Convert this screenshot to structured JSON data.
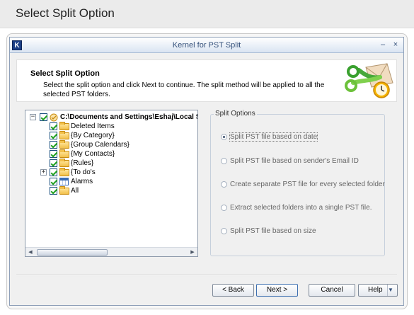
{
  "page": {
    "title": "Select Split Option"
  },
  "window": {
    "app_icon": "K",
    "title": "Kernel for PST Split",
    "minimize_glyph": "–",
    "close_glyph": "×"
  },
  "header": {
    "title": "Select Split Option",
    "description": "Select the split option and click Next to continue. The split method will be applied to all the selected PST folders.",
    "logo_icon": "scissors-clock-envelope-icon"
  },
  "tree": {
    "root": {
      "label": "C:\\Documents and Settings\\Eshaj\\Local S",
      "expander": "−",
      "checked": true
    },
    "items": [
      {
        "label": "Deleted Items",
        "icon": "folder-icon",
        "checked": true,
        "expander": ""
      },
      {
        "label": "{By Category}",
        "icon": "folder-icon",
        "checked": true,
        "expander": ""
      },
      {
        "label": "{Group Calendars}",
        "icon": "folder-icon",
        "checked": true,
        "expander": ""
      },
      {
        "label": "{My Contacts}",
        "icon": "folder-icon",
        "checked": true,
        "expander": ""
      },
      {
        "label": "{Rules}",
        "icon": "folder-icon",
        "checked": true,
        "expander": ""
      },
      {
        "label": "{To do's",
        "icon": "folder-icon",
        "checked": true,
        "expander": "+"
      },
      {
        "label": "Alarms",
        "icon": "calendar-icon",
        "checked": true,
        "expander": ""
      },
      {
        "label": "All",
        "icon": "folder-icon",
        "checked": true,
        "expander": ""
      }
    ],
    "scroll_left": "◀",
    "scroll_right": "▶"
  },
  "split_options": {
    "legend": "Split Options",
    "options": [
      {
        "label": "Split PST file based on date",
        "selected": true
      },
      {
        "label": "Split PST file based on sender's Email ID",
        "selected": false
      },
      {
        "label": "Create separate PST file for every selected folder",
        "selected": false
      },
      {
        "label": "Extract selected folders into a single PST file.",
        "selected": false
      },
      {
        "label": "Split PST file based on size",
        "selected": false
      }
    ]
  },
  "buttons": {
    "back": "< Back",
    "next": "Next >",
    "cancel": "Cancel",
    "help": "Help",
    "help_dropdown": "▼"
  }
}
